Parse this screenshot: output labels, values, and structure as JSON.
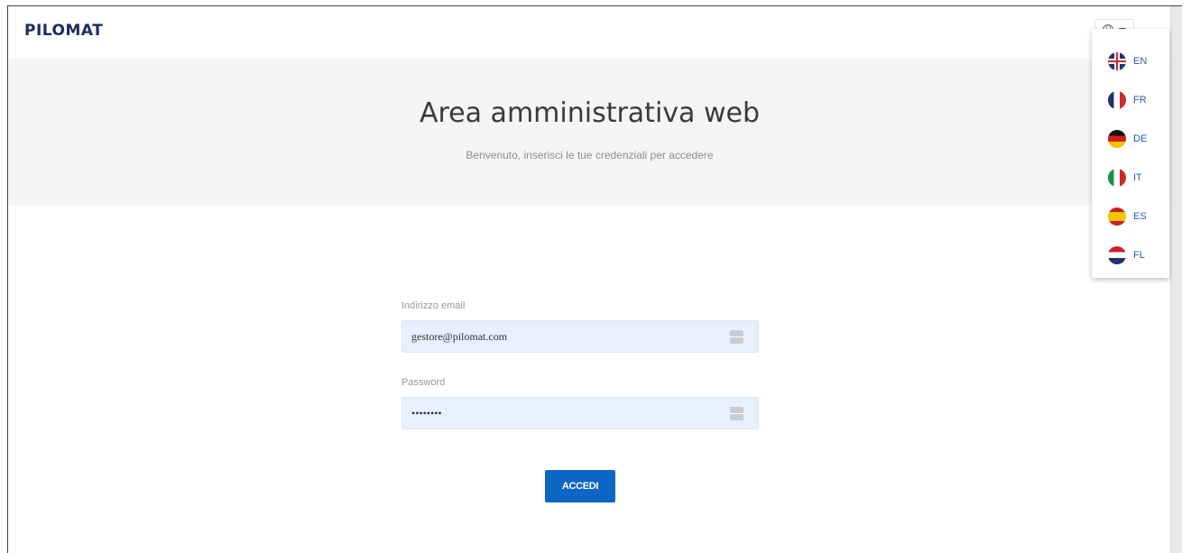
{
  "header": {
    "logo_text": "PILOMAT",
    "language_icon": "globe-icon"
  },
  "hero": {
    "title": "Area amministrativa web",
    "subtitle": "Benvenuto, inserisci le tue credenziali per accedere"
  },
  "login_form": {
    "email_label": "Indirizzo email",
    "email_value": "gestore@pilomat.com",
    "password_label": "Password",
    "password_value": "••••••••",
    "submit_label": "ACCEDI"
  },
  "language_menu": {
    "items": [
      {
        "code": "EN",
        "flag": "uk-flag-icon"
      },
      {
        "code": "FR",
        "flag": "france-flag-icon"
      },
      {
        "code": "DE",
        "flag": "germany-flag-icon"
      },
      {
        "code": "IT",
        "flag": "italy-flag-icon"
      },
      {
        "code": "ES",
        "flag": "spain-flag-icon"
      },
      {
        "code": "FL",
        "flag": "netherlands-flag-icon"
      }
    ]
  },
  "colors": {
    "primary_button": "#0d66c4",
    "hero_background": "#f5f5f5",
    "autofill_background": "#e8f0fe",
    "logo": "#1d2c5e"
  }
}
